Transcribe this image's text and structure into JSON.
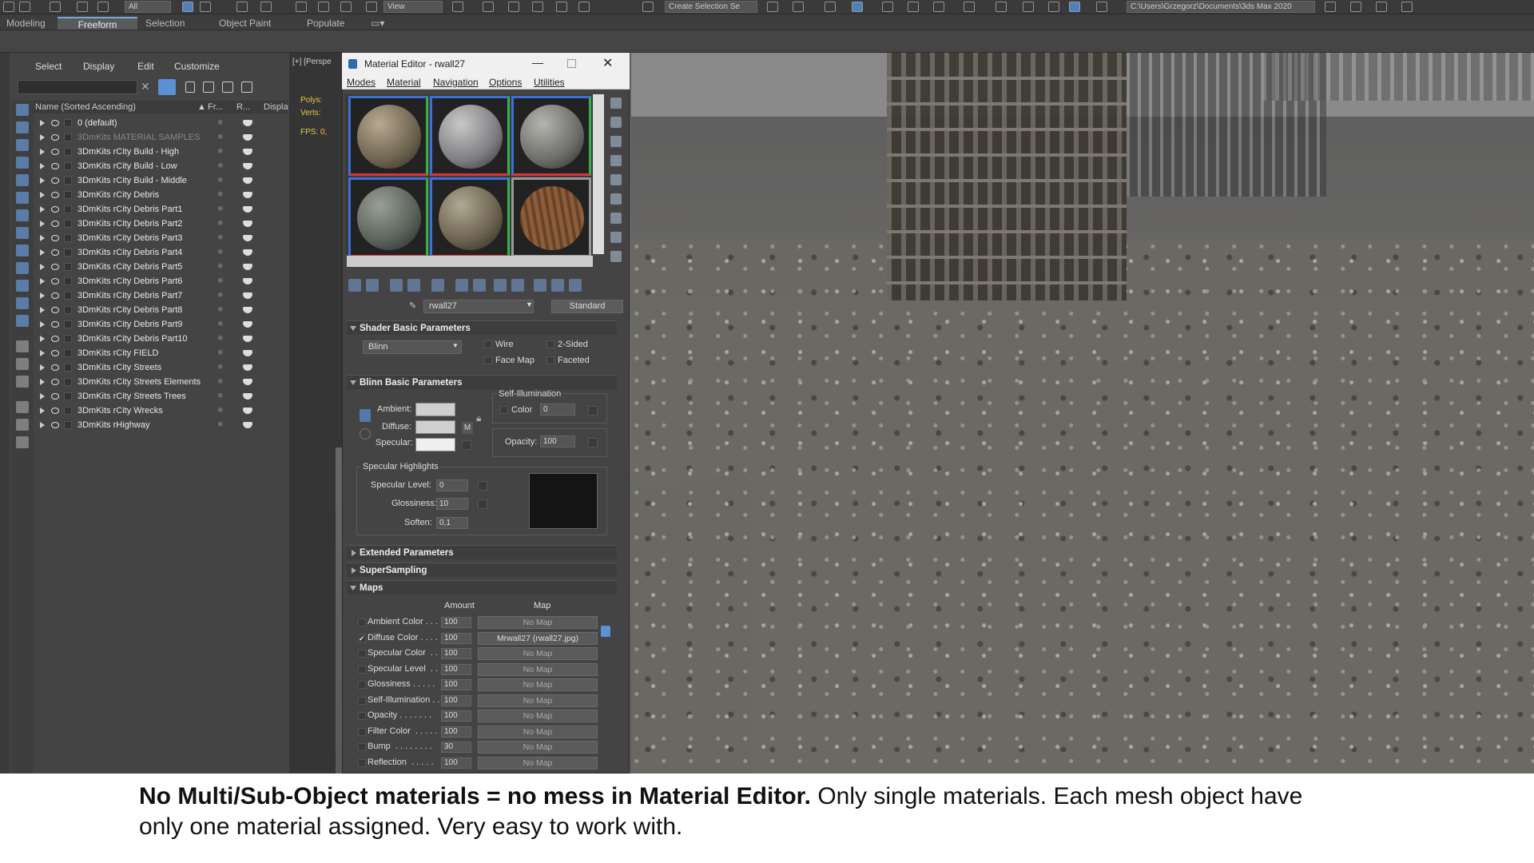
{
  "top_toolbar": {
    "selection_filter": "All",
    "view_dropdown": "View",
    "create_selection_set": "Create Selection Se",
    "project_path": "C:\\Users\\Grzegorz\\Documents\\3ds Max 2020"
  },
  "ribbon_tabs": [
    "Modeling",
    "Freeform",
    "Selection",
    "Object Paint",
    "Populate"
  ],
  "ribbon_active_tab": "Freeform",
  "scene_explorer": {
    "menu": [
      "Select",
      "Display",
      "Edit",
      "Customize"
    ],
    "columns": {
      "name": "Name (Sorted Ascending)",
      "frozen": "Fr...",
      "render": "R...",
      "display": "Displa"
    },
    "layers": [
      {
        "name": "0 (default)",
        "dim": false
      },
      {
        "name": "3DmKits MATERIAL SAMPLES",
        "dim": true
      },
      {
        "name": "3DmKits rCity Build - High",
        "dim": false
      },
      {
        "name": "3DmKits rCity Build - Low",
        "dim": false
      },
      {
        "name": "3DmKits rCity Build - Middle",
        "dim": false
      },
      {
        "name": "3DmKits rCity Debris",
        "dim": false
      },
      {
        "name": "3DmKits rCity Debris Part1",
        "dim": false
      },
      {
        "name": "3DmKits rCity Debris Part2",
        "dim": false
      },
      {
        "name": "3DmKits rCity Debris Part3",
        "dim": false
      },
      {
        "name": "3DmKits rCity Debris Part4",
        "dim": false
      },
      {
        "name": "3DmKits rCity Debris Part5",
        "dim": false
      },
      {
        "name": "3DmKits rCity Debris Part6",
        "dim": false
      },
      {
        "name": "3DmKits rCity Debris Part7",
        "dim": false
      },
      {
        "name": "3DmKits rCity Debris Part8",
        "dim": false
      },
      {
        "name": "3DmKits rCity Debris Part9",
        "dim": false
      },
      {
        "name": "3DmKits rCity Debris Part10",
        "dim": false
      },
      {
        "name": "3DmKits rCity FIELD",
        "dim": false
      },
      {
        "name": "3DmKits rCity Streets",
        "dim": false
      },
      {
        "name": "3DmKits rCity Streets Elements",
        "dim": false
      },
      {
        "name": "3DmKits rCity Streets Trees",
        "dim": false
      },
      {
        "name": "3DmKits rCity Wrecks",
        "dim": false
      },
      {
        "name": "3DmKits rHighway",
        "dim": false
      }
    ]
  },
  "viewport": {
    "label": "[+] [Perspe",
    "polys_label": "Polys:",
    "verts_label": "Verts:",
    "fps_label": "FPS:",
    "fps_value": "0,"
  },
  "material_editor": {
    "title": "Material Editor - rwall27",
    "menu": [
      "Modes",
      "Material",
      "Navigation",
      "Options",
      "Utilities"
    ],
    "material_name": "rwall27",
    "material_type": "Standard",
    "shader_rollout": "Shader Basic Parameters",
    "shader_type": "Blinn",
    "wire": "Wire",
    "two_sided": "2-Sided",
    "face_map": "Face Map",
    "faceted": "Faceted",
    "blinn_rollout": "Blinn Basic Parameters",
    "self_illum_group": "Self-Illumination",
    "color_label": "Color",
    "color_value": "0",
    "ambient_label": "Ambient:",
    "diffuse_label": "Diffuse:",
    "specular_label": "Specular:",
    "m_button": "M",
    "opacity_label": "Opacity:",
    "opacity_value": "100",
    "spec_highlights": "Specular Highlights",
    "spec_level_label": "Specular Level:",
    "spec_level_value": "0",
    "glossiness_label": "Glossiness:",
    "glossiness_value": "10",
    "soften_label": "Soften:",
    "soften_value": "0,1",
    "extended_rollout": "Extended Parameters",
    "supersampling_rollout": "SuperSampling",
    "maps_rollout": "Maps",
    "maps_amount_header": "Amount",
    "maps_map_header": "Map",
    "maps": [
      {
        "name": "Ambient Color . . .",
        "amount": "100",
        "map": "No Map",
        "checked": false
      },
      {
        "name": "Diffuse Color . . . .",
        "amount": "100",
        "map": "Mrwall27 (rwall27.jpg)",
        "checked": true
      },
      {
        "name": "Specular Color  . .",
        "amount": "100",
        "map": "No Map",
        "checked": false
      },
      {
        "name": "Specular Level  . .",
        "amount": "100",
        "map": "No Map",
        "checked": false
      },
      {
        "name": "Glossiness . . . . .",
        "amount": "100",
        "map": "No Map",
        "checked": false
      },
      {
        "name": "Self-Illumination . .",
        "amount": "100",
        "map": "No Map",
        "checked": false
      },
      {
        "name": "Opacity . . . . . . .",
        "amount": "100",
        "map": "No Map",
        "checked": false
      },
      {
        "name": "Filter Color  . . . . .",
        "amount": "100",
        "map": "No Map",
        "checked": false
      },
      {
        "name": "Bump  . . . . . . . .",
        "amount": "30",
        "map": "No Map",
        "checked": false
      },
      {
        "name": "Reflection  . . . . .",
        "amount": "100",
        "map": "No Map",
        "checked": false
      }
    ]
  },
  "caption": {
    "bold": "No Multi/Sub-Object materials = no mess in Material Editor.",
    "rest_line1": " Only single materials. Each mesh object have",
    "line2": "only one material assigned. Very easy to work with."
  }
}
